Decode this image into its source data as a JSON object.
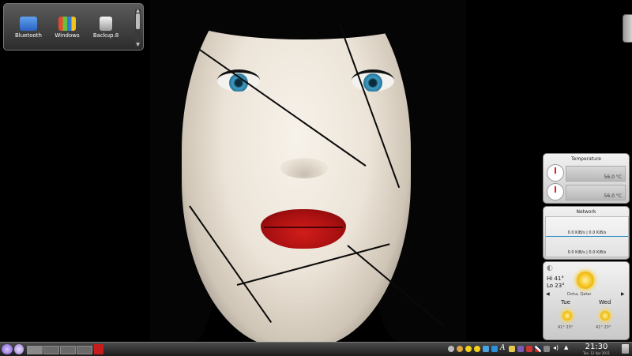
{
  "folder_view": {
    "items": [
      {
        "label": "Bluetooth",
        "icon": "bluetooth-folder-icon",
        "color": "#3b78d6"
      },
      {
        "label": "Windows",
        "icon": "windows-folder-icon",
        "color": "#2f7bd6"
      },
      {
        "label": "Backup.8",
        "icon": "backup-drive-icon",
        "color": "#e8e8e8"
      }
    ]
  },
  "temperature": {
    "title": "Temperature",
    "readings": [
      "56.0 °C",
      "56.0 °C"
    ]
  },
  "network": {
    "title": "Network",
    "top_rate": "0.0 KiB/s | 0.0 KiB/s",
    "bottom_rate": "0.0 KiB/s | 0.0 KiB/s"
  },
  "weather": {
    "current_high": "Hi 41°",
    "current_low": "Lo 23°",
    "location": "Doha, Qatar",
    "day1": "Tue",
    "day2": "Wed",
    "day1_temps": "41°  23°",
    "day2_temps": "41°  23°"
  },
  "taskbar": {
    "time": "21:30",
    "date": "Tue, 12 Apr 2011",
    "tray_icons": [
      "weather-tray-icon",
      "moon-icon",
      "sun-tray-icon",
      "sun-tray-icon",
      "network-icon",
      "chat-icon",
      "font-icon",
      "klipper-icon",
      "photo-icon",
      "tools-icon",
      "flag-icon",
      "keyboard-icon",
      "volume-icon",
      "arrow-up-icon"
    ]
  },
  "colors": {
    "accent": "#7a55c9",
    "lips": "#c8141a",
    "iris": "#3d9cc4"
  }
}
